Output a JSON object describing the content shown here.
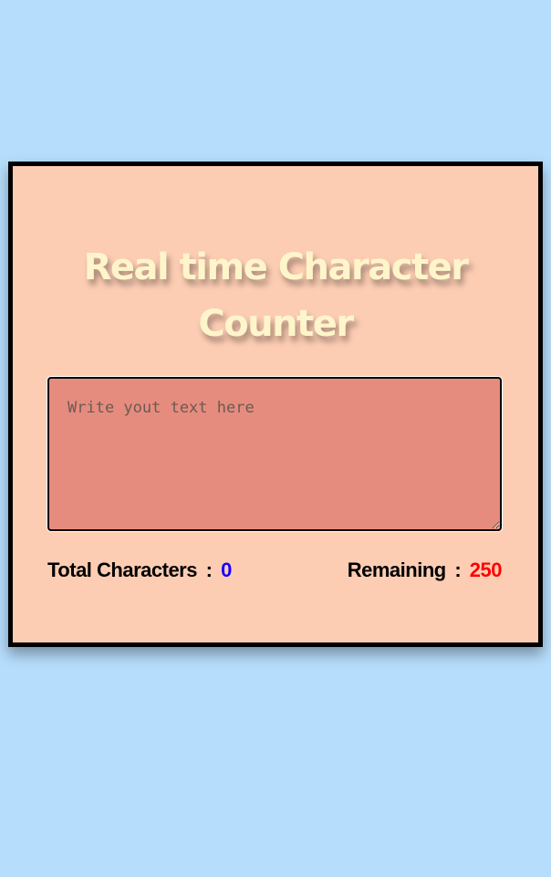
{
  "page": {
    "background_color": "#b6ddfc"
  },
  "card": {
    "background_color": "#fdcdb3",
    "border_color": "#000000",
    "title_line1": "Real time Character",
    "title_line2": "Counter",
    "title_color": "#fef5cb"
  },
  "editor": {
    "value": "",
    "placeholder": "Write yout text here",
    "background_color": "#e68c7e"
  },
  "counters": {
    "total_label": "Total Characters",
    "separator": ":",
    "total_value": "0",
    "total_color": "#1500ff",
    "remaining_label": "Remaining",
    "remaining_value": "250",
    "remaining_color": "#ff0000"
  }
}
